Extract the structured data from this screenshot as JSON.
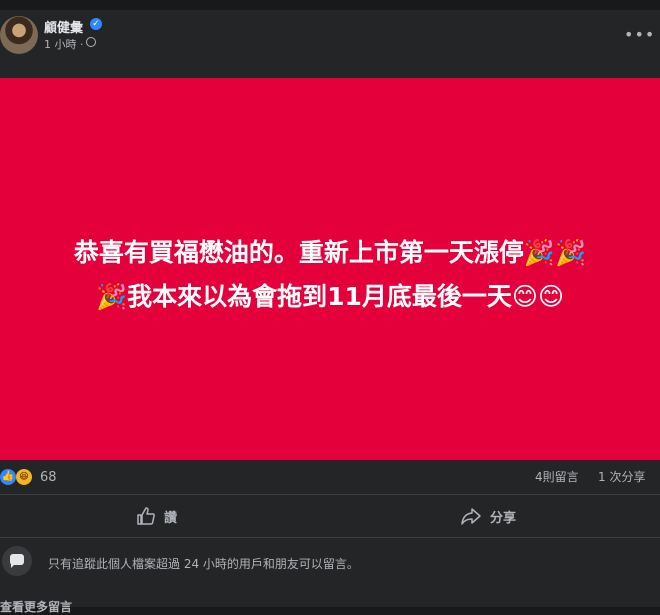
{
  "post": {
    "author": "顧健彙",
    "time": "1 小時",
    "time_sep": "·",
    "more_label": "•••",
    "image_text": {
      "line1": "恭喜有買福懋油的。重新上市第一天漲停🎉🎉",
      "line2": "🎉我本來以為會拖到11月底最後一天😊😊"
    },
    "image_bg_color": "#e4003b"
  },
  "reactions": {
    "count": "68",
    "comments": "4則留言",
    "shares": "1 次分享",
    "icons": [
      "like-icon",
      "haha-icon"
    ]
  },
  "actions": {
    "like_label": "讚",
    "share_label": "分享"
  },
  "comment_notice": "只有追蹤此個人檔案超過 24 小時的用戶和朋友可以留言。",
  "view_more": "查看更多留言"
}
